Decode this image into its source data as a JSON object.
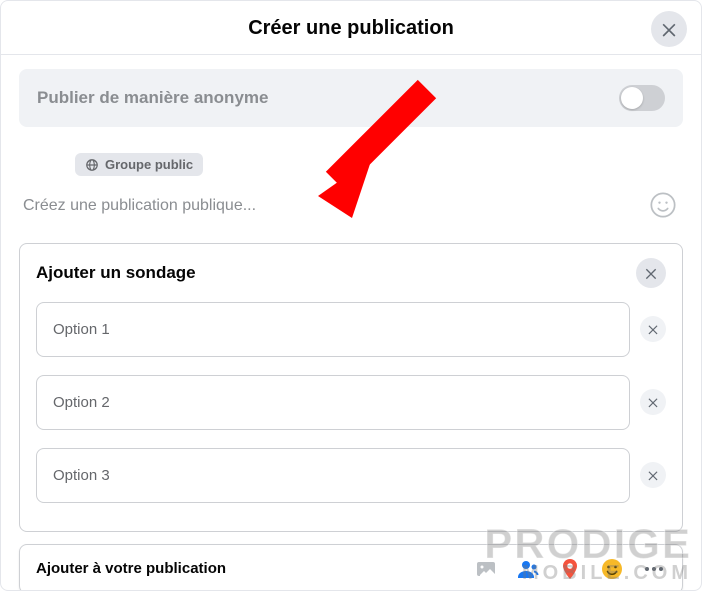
{
  "header": {
    "title": "Créer une publication"
  },
  "anonymous": {
    "label": "Publier de manière anonyme"
  },
  "audience": {
    "label": "Groupe public"
  },
  "composer": {
    "placeholder": "Créez une publication publique..."
  },
  "poll": {
    "title": "Ajouter un sondage",
    "options": [
      {
        "placeholder": "Option 1"
      },
      {
        "placeholder": "Option 2"
      },
      {
        "placeholder": "Option 3"
      }
    ]
  },
  "addBar": {
    "label": "Ajouter à votre publication"
  },
  "watermark": {
    "line1": "PRODIGE",
    "line2": "MOBILE.COM"
  }
}
